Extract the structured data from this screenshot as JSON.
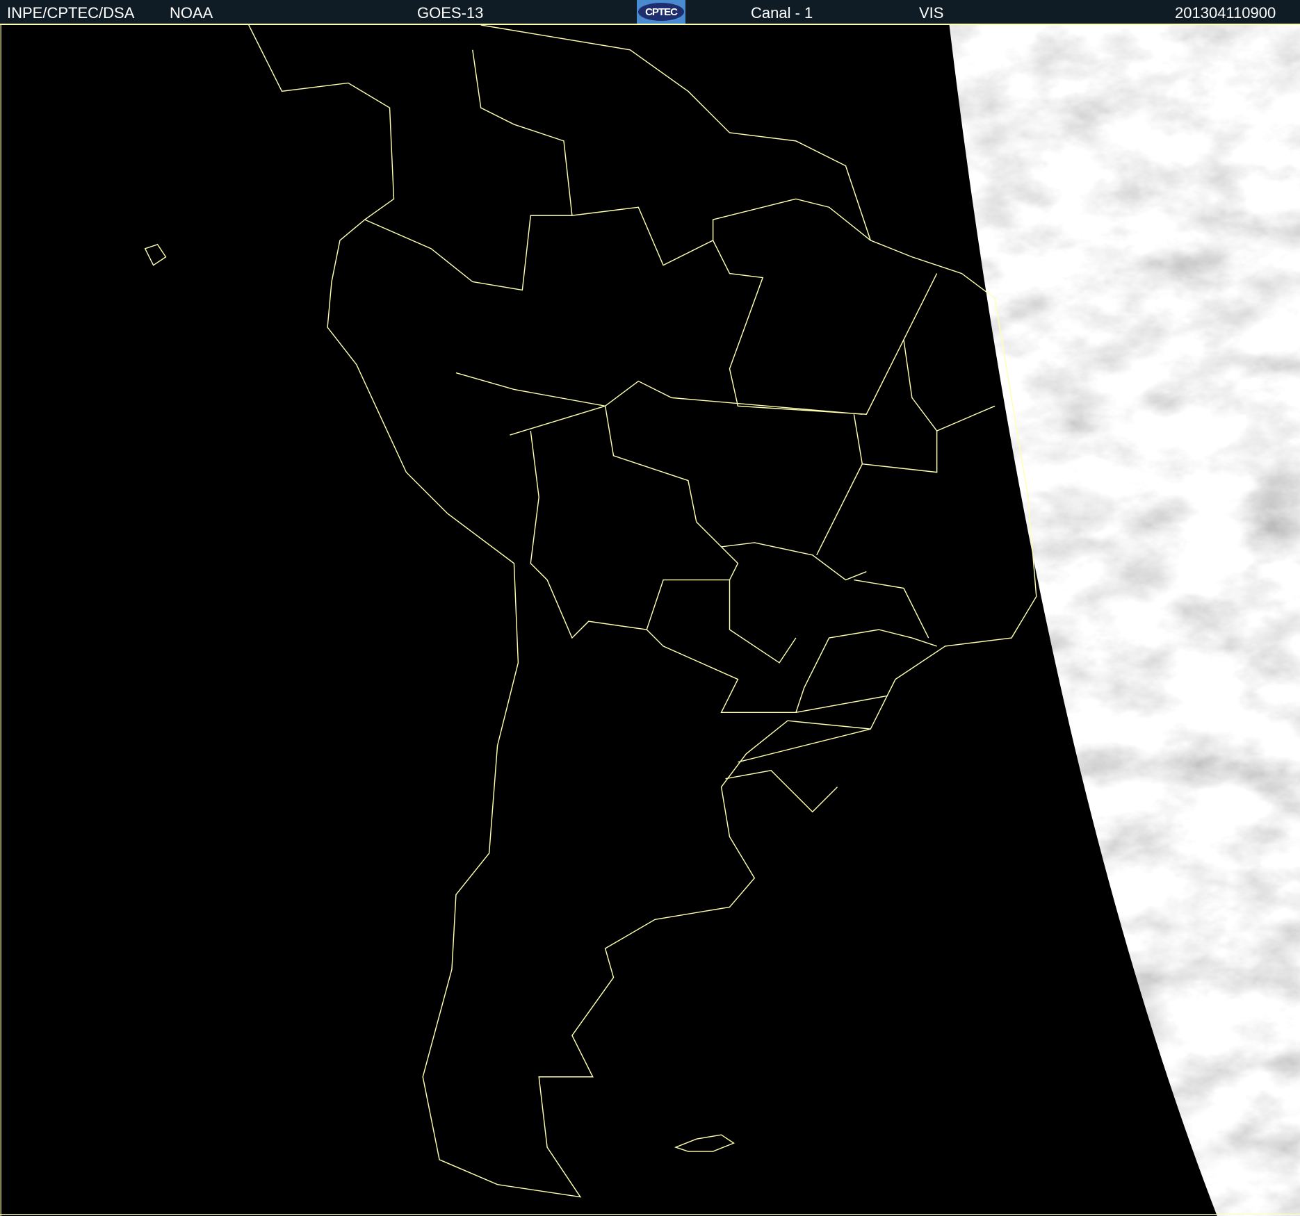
{
  "header": {
    "org": "INPE/CPTEC/DSA",
    "agency": "NOAA",
    "satellite": "GOES-13",
    "logo_text": "CPTEC",
    "channel": "Canal - 1",
    "band": "VIS",
    "timestamp": "201304110900"
  },
  "colors": {
    "header_bg": "#101c25",
    "border_lines": "#ffffb0",
    "background": "#000000"
  }
}
